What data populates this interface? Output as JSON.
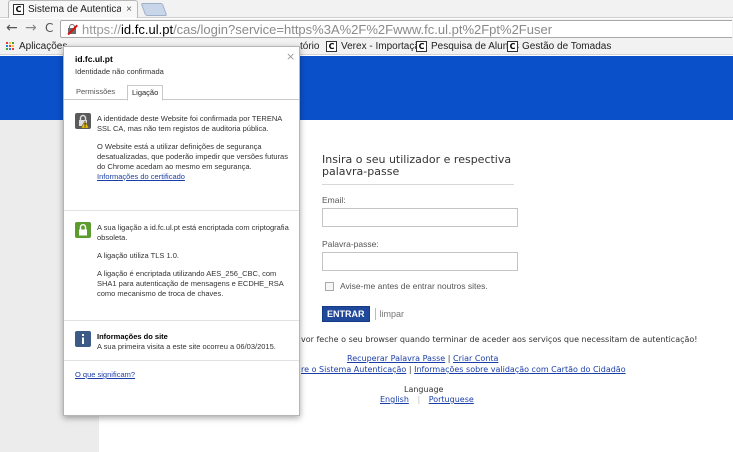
{
  "browser": {
    "tab_title": "Sistema de Autenticação",
    "tab_close": "×",
    "url_scheme": "https://",
    "url_host": "id.fc.ul.pt",
    "url_rest": "/cas/login?service=https%3A%2F%2Fwww.fc.ul.pt%2Fpt%2Fuser",
    "back": "←",
    "forward": "→",
    "reload": "C",
    "favicon_letter": "C"
  },
  "bookmarks": {
    "apps_label": "Aplicações",
    "items": [
      "tório",
      "Verex - Importação",
      "Pesquisa de Alunos",
      "Gestão de Tomadas"
    ]
  },
  "popup": {
    "domain": "id.fc.ul.pt",
    "status": "Identidade não confirmada",
    "close": "×",
    "tabs": [
      "Permissões",
      "Ligação"
    ],
    "identity": {
      "p1": "A identidade deste Website foi confirmada por TERENA SSL CA, mas não tem registos de auditoria pública.",
      "p2": "O Website está a utilizar definições de segurança desatualizadas, que poderão impedir que versões futuras do Chrome acedam ao mesmo em segurança.",
      "link": "Informações do certificado"
    },
    "connection": {
      "p1": "A sua ligação a id.fc.ul.pt está encriptada com criptografia obsoleta.",
      "p2": "A ligação utiliza TLS 1.0.",
      "p3": "A ligação é encriptada utilizando AES_256_CBC, com SHA1 para autenticação de mensagens e ECDHE_RSA como mecanismo de troca de chaves."
    },
    "site_info": {
      "title": "Informações do site",
      "text": "A sua primeira visita a este site ocorreu a 06/03/2015."
    },
    "footer_link": "O que significam?",
    "colors": {
      "warning_icon": "#5a5a5a",
      "lock_icon": "#5c9c2f",
      "info_icon": "#3b5a86"
    }
  },
  "login": {
    "title": "Insira o seu utilizador e respectiva palavra-passe",
    "email_label": "Email:",
    "password_label": "Palavra-passe:",
    "warn_label": "Avise-me antes de entrar noutros sites.",
    "submit": "ENTRAR",
    "clear": "limpar"
  },
  "footer": {
    "notice": "vor feche o seu browser quando terminar de aceder aos serviços que necessitam de autenticação!",
    "recover": "Recuperar Palavra Passe",
    "create": "Criar Conta",
    "about": "re o Sistema Autenticação",
    "cc": "Informações sobre validação com Cartão do Cidadão",
    "language_label": "Language",
    "english": "English",
    "portuguese": "Portuguese"
  },
  "colors": {
    "header_blue": "#0a51c9",
    "button_blue": "#20489b",
    "link": "#1a3ea8"
  }
}
